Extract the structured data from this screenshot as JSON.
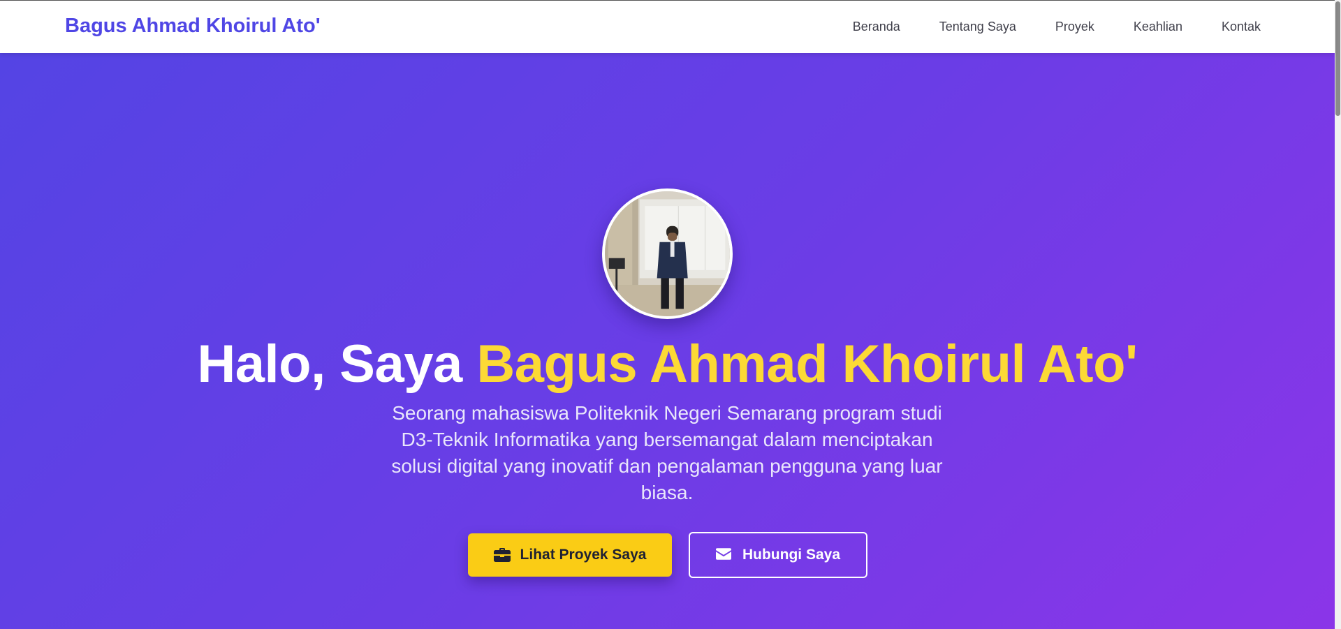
{
  "nav": {
    "brand": "Bagus Ahmad Khoirul Ato'",
    "links": [
      "Beranda",
      "Tentang Saya",
      "Proyek",
      "Keahlian",
      "Kontak"
    ]
  },
  "hero": {
    "title_prefix": "Halo, Saya ",
    "title_name": "Bagus Ahmad Khoirul Ato'",
    "description": "Seorang mahasiswa Politeknik Negeri Semarang program studi D3-Teknik Informatika yang bersemangat dalam menciptakan solusi digital yang inovatif dan pengalaman pengguna yang luar biasa.",
    "primary_button": {
      "label": "Lihat Proyek Saya",
      "icon": "briefcase-icon"
    },
    "secondary_button": {
      "label": "Hubungi Saya",
      "icon": "envelope-icon"
    }
  },
  "colors": {
    "brand": "#4f46e5",
    "accent_name": "#fcd935",
    "primary_button_bg": "#facc15",
    "hero_gradient_start": "#5444e4",
    "hero_gradient_end": "#8b35e8"
  }
}
